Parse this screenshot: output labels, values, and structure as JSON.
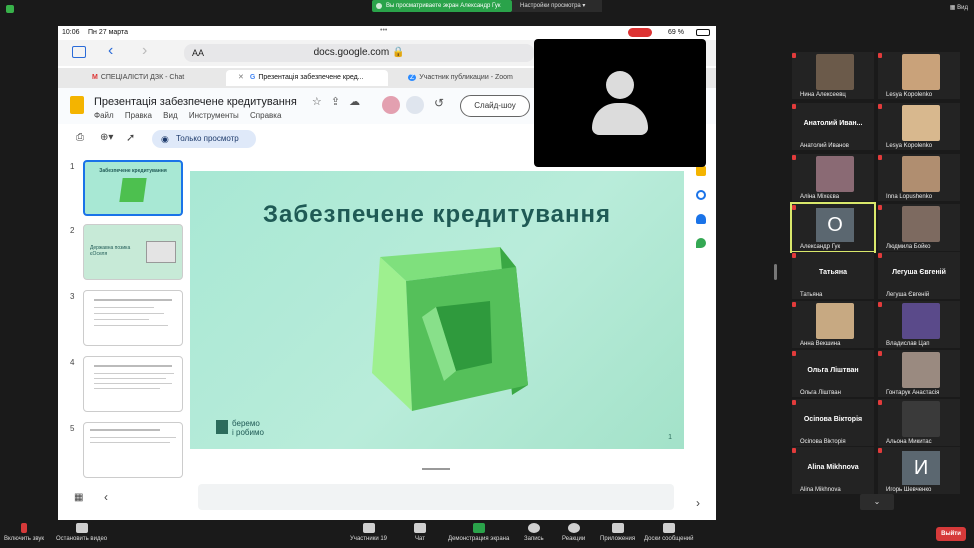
{
  "zoom_top": {
    "share_notice": "Вы просматриваете экран Александр Гук",
    "view_settings": "Настройки просмотра",
    "view": "Вид"
  },
  "ipad": {
    "status": {
      "time": "10:06",
      "date": "Пн 27 марта",
      "battery": "69 %"
    },
    "url_bar": {
      "text_size": "AA",
      "url": "docs.google.com"
    },
    "tabs": [
      {
        "label": "СПЕЦІАЛІСТИ ДЗК - Chat"
      },
      {
        "label": "Презентація забезпечене кред..."
      },
      {
        "label": "Участник публикации - Zoom"
      }
    ],
    "docs": {
      "title": "Презентація забезпечене кредитування",
      "menu": [
        "Файл",
        "Правка",
        "Вид",
        "Инструменты",
        "Справка"
      ],
      "slideshow_button": "Слайд-шоу",
      "readonly_label": "Только просмотр"
    },
    "thumbnails": [
      {
        "number": "1",
        "text": "Забезпечене кредитування"
      },
      {
        "number": "2",
        "text": "Державна позика єОселя"
      },
      {
        "number": "3",
        "text": ""
      },
      {
        "number": "4",
        "text": ""
      },
      {
        "number": "5",
        "text": ""
      }
    ],
    "slide": {
      "title": "Забезпечене кредитування",
      "brand_line1": "беремо",
      "brand_line2": "і робимо",
      "page_number": "1"
    }
  },
  "participants": [
    {
      "name": "Нина Алексеевц",
      "display": "",
      "kind": "photo",
      "color": "#6b5a4a"
    },
    {
      "name": "Lesya Kopolenko",
      "display": "",
      "kind": "photo",
      "color": "#c9a27a"
    },
    {
      "name": "Анатолий Иванов",
      "display": "Анатолий Иван...",
      "kind": "name",
      "color": ""
    },
    {
      "name": "Lesya Kopolenko",
      "display": "",
      "kind": "photo",
      "color": "#d8b88e"
    },
    {
      "name": "Аліна Міхєєва",
      "display": "",
      "kind": "photo",
      "color": "#8a6a74"
    },
    {
      "name": "Inna Lopushenko",
      "display": "",
      "kind": "photo",
      "color": "#b08e70"
    },
    {
      "name": "Александр Гук",
      "display": "O",
      "kind": "initial",
      "color": ""
    },
    {
      "name": "Людмила Бойко",
      "display": "",
      "kind": "photo",
      "color": "#7d6a60"
    },
    {
      "name": "Татьяна",
      "display": "Татьяна",
      "kind": "name",
      "color": ""
    },
    {
      "name": "Легуша Євгеній",
      "display": "Легуша Євгеній",
      "kind": "name",
      "color": ""
    },
    {
      "name": "Анна Векшина",
      "display": "",
      "kind": "photo",
      "color": "#c7a982"
    },
    {
      "name": "Владислав Цап",
      "display": "",
      "kind": "photo",
      "color": "#5a4a8a"
    },
    {
      "name": "Ольга Ліштван",
      "display": "Ольга Ліштван",
      "kind": "name",
      "color": ""
    },
    {
      "name": "Гонтарук Анастасія",
      "display": "",
      "kind": "photo",
      "color": "#9a8a80"
    },
    {
      "name": "Осіпова Вікторія",
      "display": "Осіпова Вікторія",
      "kind": "name",
      "color": ""
    },
    {
      "name": "Альона Микитас",
      "display": "",
      "kind": "photo",
      "color": "#3a3a3a"
    },
    {
      "name": "Alina Mikhnova",
      "display": "Alina Mikhnova",
      "kind": "name",
      "color": ""
    },
    {
      "name": "Игорь Шевченко",
      "display": "И",
      "kind": "initial",
      "color": ""
    }
  ],
  "zoom_bar": {
    "unmute": "Включить звук",
    "stop_video": "Остановить видео",
    "participants": "Участники",
    "participants_count": "19",
    "chat": "Чат",
    "share_screen": "Демонстрация экрана",
    "record": "Запись",
    "reactions": "Реакции",
    "apps": "Приложения",
    "whiteboards": "Доски сообщений",
    "leave": "Выйти"
  }
}
